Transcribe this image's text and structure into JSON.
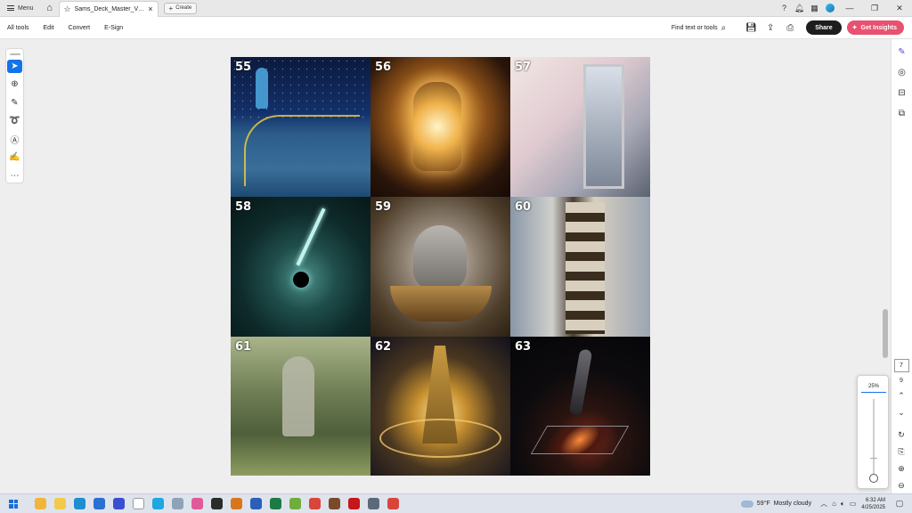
{
  "titlebar": {
    "menu_label": "Menu",
    "tab_title": "Sams_Deck_Master_Vis...",
    "tab_close": "×",
    "create_label": "Create",
    "create_plus": "+",
    "home_glyph": "⌂",
    "star_glyph": "☆"
  },
  "toolbar": {
    "menu_items": [
      "All tools",
      "Edit",
      "Convert",
      "E-Sign"
    ],
    "find_label": "Find text or tools",
    "share_label": "Share",
    "insights_label": "Get Insights"
  },
  "page": {
    "cells": [
      {
        "number": "55"
      },
      {
        "number": "56"
      },
      {
        "number": "57"
      },
      {
        "number": "58"
      },
      {
        "number": "59"
      },
      {
        "number": "60"
      },
      {
        "number": "61"
      },
      {
        "number": "62"
      },
      {
        "number": "63"
      }
    ]
  },
  "page_nav": {
    "current_page": "7",
    "total_pages": "9"
  },
  "zoom": {
    "value": "25%",
    "level_percent": 25
  },
  "taskbar": {
    "weather_temp": "59°F",
    "weather_desc": "Mostly cloudy",
    "time": "6:32 AM",
    "date": "4/25/2025",
    "apps": [
      {
        "icon": "calendar-icon",
        "color": "#f1b53a"
      },
      {
        "icon": "file-explorer-icon",
        "color": "#f3c94b"
      },
      {
        "icon": "edge-icon",
        "color": "#1d8fd1"
      },
      {
        "icon": "mail-icon",
        "color": "#2a6fd2"
      },
      {
        "icon": "chat-icon",
        "color": "#3a4fd0"
      },
      {
        "icon": "document-icon",
        "color": "#ffffff"
      },
      {
        "icon": "skype-icon",
        "color": "#1ea7e1"
      },
      {
        "icon": "photos-icon",
        "color": "#8fa3b8"
      },
      {
        "icon": "paint-icon",
        "color": "#e05a9a"
      },
      {
        "icon": "terminal-icon",
        "color": "#2b2b2b"
      },
      {
        "icon": "media-icon",
        "color": "#d9761c"
      },
      {
        "icon": "word-icon",
        "color": "#2b5fb8"
      },
      {
        "icon": "excel-icon",
        "color": "#1e7a45"
      },
      {
        "icon": "notepad-icon",
        "color": "#6fae3b"
      },
      {
        "icon": "chrome-icon",
        "color": "#d8453a"
      },
      {
        "icon": "game-icon",
        "color": "#7a4a2a"
      },
      {
        "icon": "acrobat-icon",
        "color": "#c8161d"
      },
      {
        "icon": "calculator-icon",
        "color": "#5a6a7a"
      },
      {
        "icon": "chrome-icon",
        "color": "#d8453a"
      }
    ]
  },
  "colors": {
    "accent": "#1473e6",
    "insights": "#e8516f",
    "share": "#1d1d1d"
  }
}
